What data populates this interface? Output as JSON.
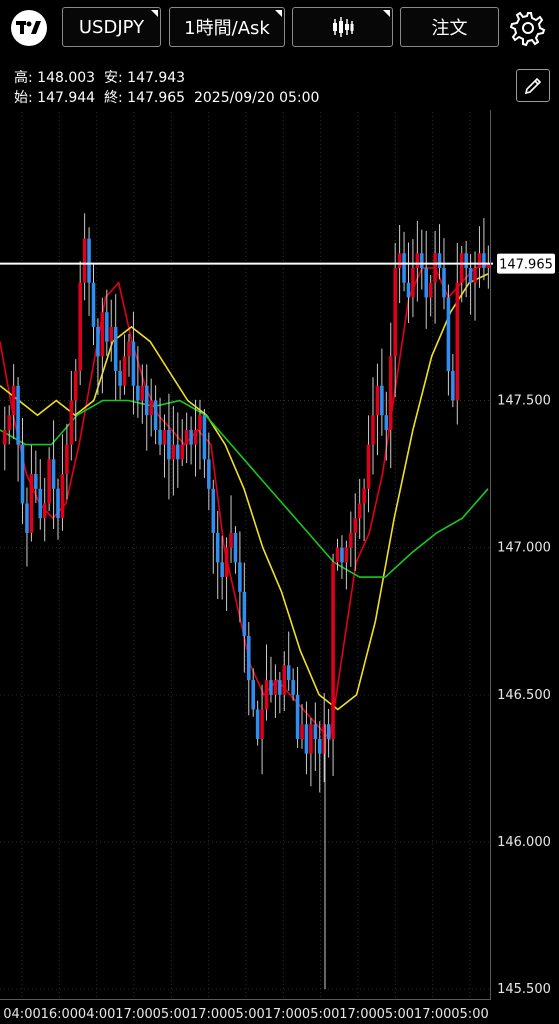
{
  "header": {
    "symbol": "USDJPY",
    "timeframe": "1時間/Ask",
    "order": "注文",
    "icons": [
      "tradingview-logo-icon",
      "candlestick-icon",
      "gear-icon",
      "pencil-icon"
    ]
  },
  "ohlc": {
    "high_label": "高:",
    "high": "148.003",
    "low_label": "安:",
    "low": "147.943",
    "open_label": "始:",
    "open": "147.944",
    "close_label": "終:",
    "close": "147.965",
    "timestamp": "2025/09/20 05:00"
  },
  "colors": {
    "background": "#000000",
    "grid": "#2e2e2e",
    "up_candle": "#e0001b",
    "down_candle": "#2f8ff0",
    "wick": "#cccccc",
    "ma_fast": "#e0001b",
    "ma_mid": "#f0e020",
    "ma_slow": "#18c81e",
    "price_line": "#ffffff"
  },
  "chart_data": {
    "type": "candlestick",
    "y_ticks": [
      "147.500",
      "147.000",
      "146.500",
      "146.000",
      "145.500"
    ],
    "ylim": [
      145.47,
      148.48
    ],
    "x_ticks": [
      "04:00",
      "16:00",
      "04:00",
      "17:00",
      "05:00",
      "17:00",
      "05:00",
      "17:00",
      "05:00",
      "17:00",
      "05:00",
      "17:00",
      "05:00"
    ],
    "current_price": "147.965",
    "series_prices": [
      147.4,
      147.45,
      147.55,
      147.35,
      147.15,
      147.05,
      147.25,
      147.2,
      147.1,
      147.15,
      147.3,
      147.2,
      147.1,
      147.25,
      147.35,
      147.5,
      147.6,
      147.9,
      148.05,
      147.9,
      147.75,
      147.65,
      147.8,
      147.7,
      147.75,
      147.6,
      147.55,
      147.65,
      147.7,
      147.55,
      147.5,
      147.55,
      147.45,
      147.5,
      147.4,
      147.35,
      147.4,
      147.3,
      147.35,
      147.3,
      147.35,
      147.4,
      147.35,
      147.4,
      147.45,
      147.3,
      147.2,
      147.05,
      146.95,
      146.9,
      147.0,
      147.05,
      146.95,
      146.85,
      146.7,
      146.55,
      146.45,
      146.35,
      146.45,
      146.55,
      146.5,
      146.55,
      146.5,
      146.6,
      146.55,
      146.5,
      146.35,
      146.4,
      146.3,
      146.4,
      146.35,
      146.3,
      146.4,
      146.35,
      146.95,
      147.0,
      146.95,
      147.0,
      147.05,
      147.1,
      147.15,
      147.2,
      147.35,
      147.45,
      147.55,
      147.45,
      147.4,
      147.65,
      147.95,
      148.0,
      147.9,
      147.85,
      147.95,
      148.0,
      147.95,
      147.85,
      147.9,
      148.0,
      147.95,
      147.85,
      147.6,
      147.5,
      147.9,
      148.0,
      147.95,
      147.9,
      147.95,
      148.0,
      147.95,
      147.965
    ],
    "moving_averages": [
      {
        "color": "#e0001b",
        "values": [
          147.7,
          147.45,
          147.25,
          147.15,
          147.1,
          147.15,
          147.35,
          147.6,
          147.85,
          147.9,
          147.7,
          147.55,
          147.45,
          147.4,
          147.35,
          147.4,
          147.35,
          147.0,
          146.8,
          146.6,
          146.5,
          146.55,
          146.5,
          146.45,
          146.4,
          146.35,
          146.65,
          146.95,
          147.05,
          147.25,
          147.55,
          147.85,
          147.95,
          147.95,
          147.85,
          147.9,
          147.95,
          147.96
        ]
      },
      {
        "color": "#f0e020",
        "values": [
          147.55,
          147.5,
          147.45,
          147.5,
          147.45,
          147.5,
          147.7,
          147.75,
          147.7,
          147.6,
          147.5,
          147.45,
          147.35,
          147.2,
          147.0,
          146.85,
          146.65,
          146.5,
          146.45,
          146.5,
          146.75,
          147.1,
          147.4,
          147.65,
          147.8,
          147.9,
          147.93
        ]
      },
      {
        "color": "#18c81e",
        "values": [
          147.4,
          147.35,
          147.35,
          147.45,
          147.5,
          147.5,
          147.48,
          147.5,
          147.45,
          147.35,
          147.25,
          147.15,
          147.05,
          146.95,
          146.9,
          146.9,
          146.98,
          147.05,
          147.1,
          147.2
        ]
      }
    ]
  }
}
